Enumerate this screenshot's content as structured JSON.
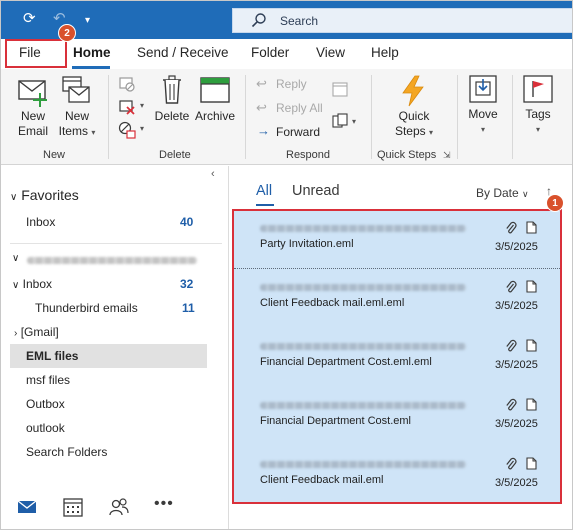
{
  "titlebar": {
    "search_placeholder": "Search",
    "accent": "#1f6cb8",
    "quick_access": [
      "sync-icon",
      "undo-icon",
      "customize-icon"
    ]
  },
  "menu": {
    "tabs": [
      "File",
      "Home",
      "Send / Receive",
      "Folder",
      "View",
      "Help"
    ],
    "active": "Home"
  },
  "annotations": {
    "file_badge": "2",
    "list_badge": "1",
    "highlight_color": "#d9303a",
    "badge_color": "#d9512c"
  },
  "ribbon": {
    "new_email": [
      "New",
      "Email"
    ],
    "new_items": [
      "New",
      "Items"
    ],
    "delete": "Delete",
    "archive": "Archive",
    "reply": "Reply",
    "reply_all": "Reply All",
    "forward": "Forward",
    "quick_steps": [
      "Quick",
      "Steps"
    ],
    "move": "Move",
    "tags": "Tags",
    "groups": {
      "new": "New",
      "delete": "Delete",
      "respond": "Respond",
      "quick_steps": "Quick Steps"
    }
  },
  "nav": {
    "favorites": "Favorites",
    "fav_inbox": "Inbox",
    "fav_inbox_count": "40",
    "inbox": "Inbox",
    "inbox_count": "32",
    "thunderbird": "Thunderbird emails",
    "thunderbird_count": "11",
    "gmail": "[Gmail]",
    "eml_files": "EML files",
    "msf_files": "msf files",
    "outbox": "Outbox",
    "outlook": "outlook",
    "search_folders": "Search Folders",
    "bottom_icons": [
      "mail-icon",
      "calendar-icon",
      "people-icon",
      "more-icon"
    ]
  },
  "list": {
    "tab_all": "All",
    "tab_unread": "Unread",
    "sort": "By Date",
    "messages": [
      {
        "subject": "Party Invitation.eml",
        "date": "3/5/2025"
      },
      {
        "subject": "Client Feedback mail.eml.eml",
        "date": "3/5/2025"
      },
      {
        "subject": "Financial Department Cost.eml.eml",
        "date": "3/5/2025"
      },
      {
        "subject": "Financial Department Cost.eml",
        "date": "3/5/2025"
      },
      {
        "subject": "Client Feedback mail.eml",
        "date": "3/5/2025"
      }
    ]
  }
}
